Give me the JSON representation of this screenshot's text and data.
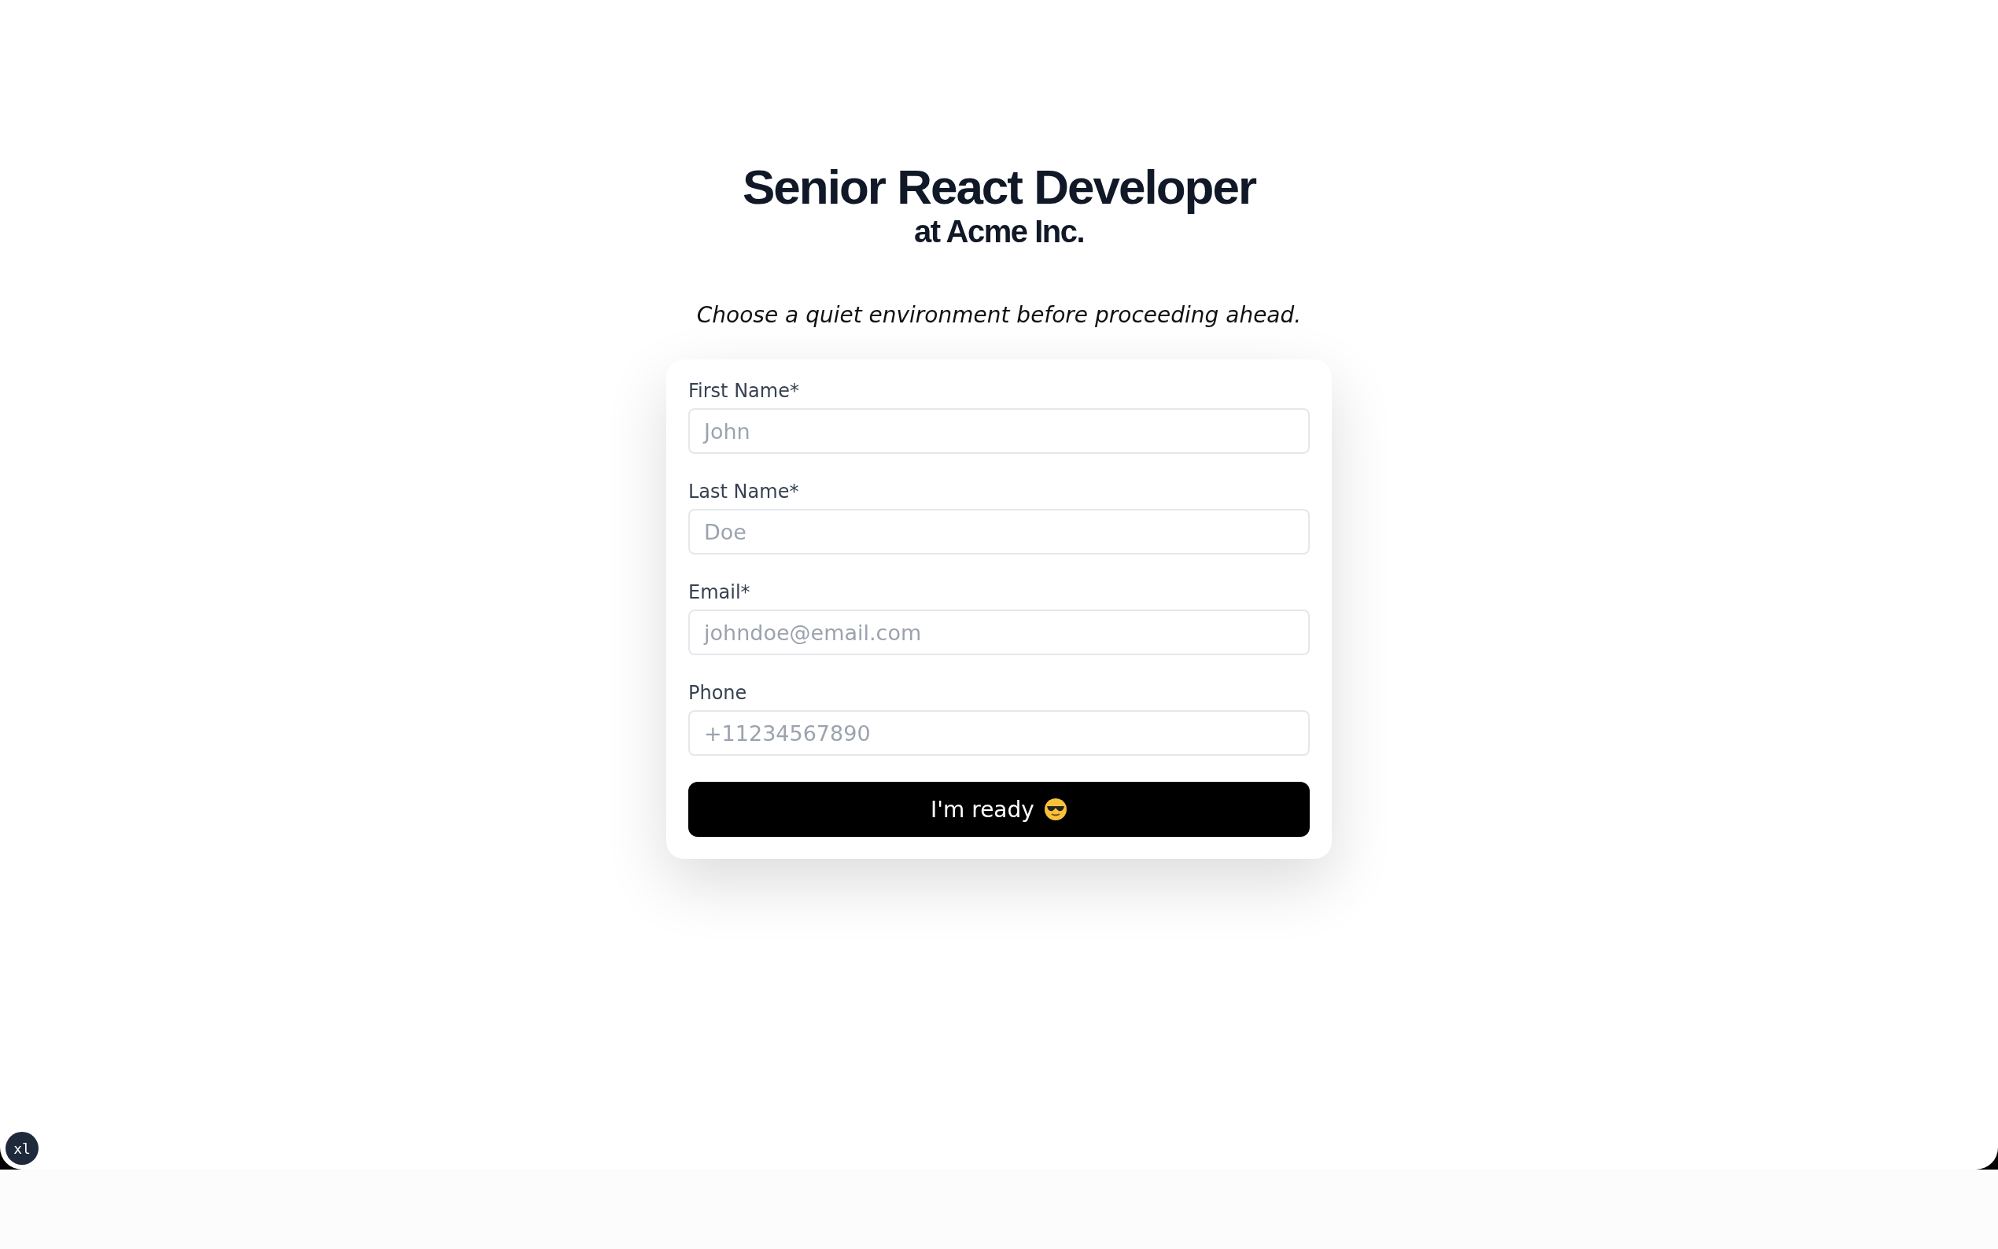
{
  "header": {
    "title": "Senior React Developer",
    "subtitle": "at Acme Inc."
  },
  "note": "Choose a quiet environment before proceeding ahead.",
  "form": {
    "fields": [
      {
        "label": "First Name*",
        "placeholder": "John"
      },
      {
        "label": "Last Name*",
        "placeholder": "Doe"
      },
      {
        "label": "Email*",
        "placeholder": "johndoe@email.com"
      },
      {
        "label": "Phone",
        "placeholder": "+11234567890"
      }
    ],
    "submit": {
      "label": "I'm ready"
    }
  },
  "badge": "xl"
}
